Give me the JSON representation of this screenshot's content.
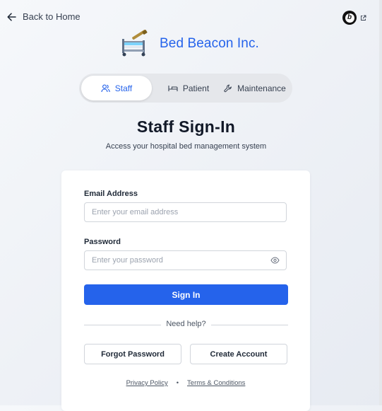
{
  "nav": {
    "back_label": "Back to Home"
  },
  "brand": {
    "name": "Bed Beacon Inc.",
    "badge_letter": "b"
  },
  "tabs": [
    {
      "label": "Staff",
      "icon": "users-icon",
      "active": true
    },
    {
      "label": "Patient",
      "icon": "bed-icon",
      "active": false
    },
    {
      "label": "Maintenance",
      "icon": "wrench-icon",
      "active": false
    }
  ],
  "heading": {
    "title": "Staff Sign-In",
    "subtitle": "Access your hospital bed management system"
  },
  "form": {
    "email_label": "Email Address",
    "email_placeholder": "Enter your email address",
    "password_label": "Password",
    "password_placeholder": "Enter your password",
    "signin_label": "Sign In",
    "help_text": "Need help?",
    "forgot_label": "Forgot Password",
    "create_label": "Create Account"
  },
  "footer": {
    "privacy": "Privacy Policy",
    "separator": "•",
    "terms": "Terms & Conditions"
  },
  "colors": {
    "accent": "#2563eb",
    "tab_track": "#e5e7eb"
  }
}
